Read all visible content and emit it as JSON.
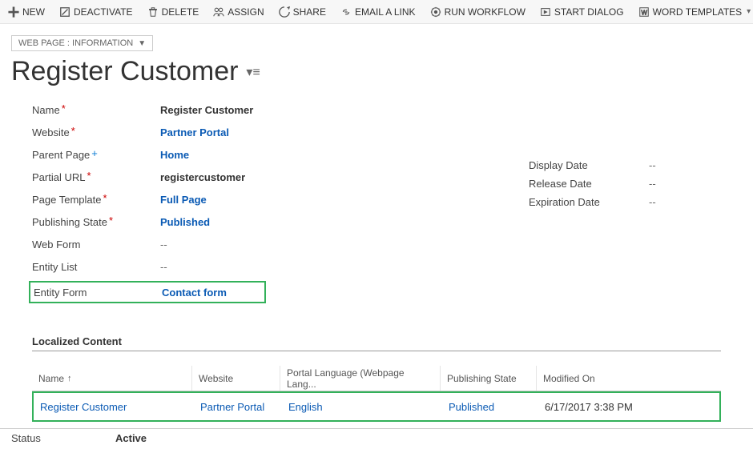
{
  "toolbar": {
    "new": "NEW",
    "deactivate": "DEACTIVATE",
    "delete": "DELETE",
    "assign": "ASSIGN",
    "share": "SHARE",
    "email_link": "EMAIL A LINK",
    "run_workflow": "RUN WORKFLOW",
    "start_dialog": "START DIALOG",
    "word_templates": "WORD TEMPLATES"
  },
  "form_selector": "WEB PAGE : INFORMATION",
  "page_title": "Register Customer",
  "fields": {
    "name": {
      "label": "Name",
      "value": "Register Customer"
    },
    "website": {
      "label": "Website",
      "value": "Partner Portal"
    },
    "parent_page": {
      "label": "Parent Page",
      "value": "Home"
    },
    "partial_url": {
      "label": "Partial URL",
      "value": "registercustomer"
    },
    "page_template": {
      "label": "Page Template",
      "value": "Full Page"
    },
    "publishing_state": {
      "label": "Publishing State",
      "value": "Published"
    },
    "web_form": {
      "label": "Web Form",
      "value": "--"
    },
    "entity_list": {
      "label": "Entity List",
      "value": "--"
    },
    "entity_form": {
      "label": "Entity Form",
      "value": "Contact form"
    },
    "display_date": {
      "label": "Display Date",
      "value": "--"
    },
    "release_date": {
      "label": "Release Date",
      "value": "--"
    },
    "expiration_date": {
      "label": "Expiration Date",
      "value": "--"
    }
  },
  "section_title": "Localized Content",
  "grid": {
    "headers": {
      "name": "Name",
      "website": "Website",
      "portal_language": "Portal Language (Webpage Lang...",
      "publishing_state": "Publishing State",
      "modified_on": "Modified On"
    },
    "rows": [
      {
        "name": "Register Customer",
        "website": "Partner Portal",
        "language": "English",
        "state": "Published",
        "modified": "6/17/2017 3:38 PM"
      }
    ]
  },
  "status": {
    "label": "Status",
    "value": "Active"
  }
}
